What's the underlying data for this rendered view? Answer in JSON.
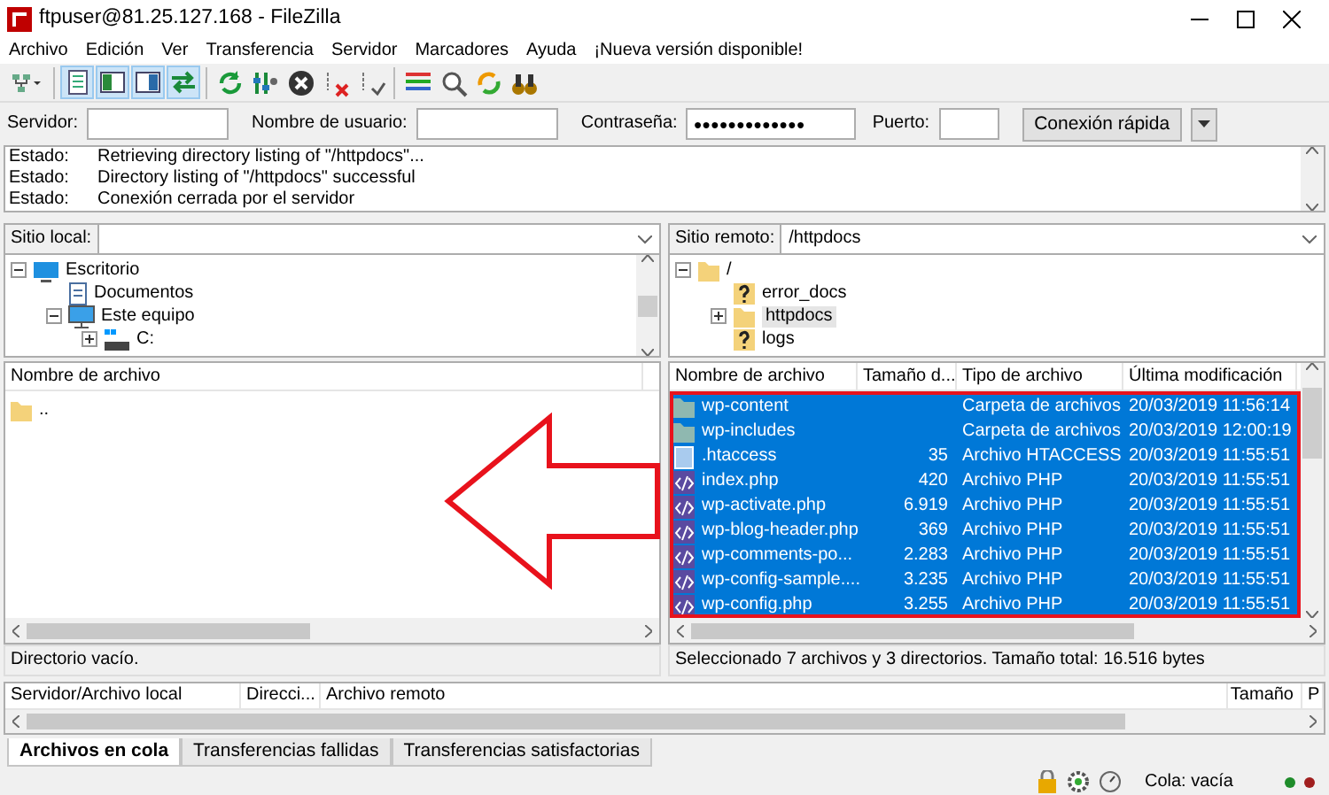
{
  "window": {
    "title": "ftpuser@81.25.127.168 - FileZilla"
  },
  "menu": [
    "Archivo",
    "Edición",
    "Ver",
    "Transferencia",
    "Servidor",
    "Marcadores",
    "Ayuda",
    "¡Nueva versión disponible!"
  ],
  "toolbar": [
    {
      "kind": "sites",
      "pressed": false
    },
    {
      "kind": "sep"
    },
    {
      "kind": "log",
      "pressed": true
    },
    {
      "kind": "localtree",
      "pressed": true
    },
    {
      "kind": "remotetree",
      "pressed": true
    },
    {
      "kind": "queue",
      "pressed": true
    },
    {
      "kind": "sep"
    },
    {
      "kind": "refresh",
      "pressed": false
    },
    {
      "kind": "filter",
      "pressed": false
    },
    {
      "kind": "cancel",
      "pressed": false
    },
    {
      "kind": "disconnect",
      "pressed": false
    },
    {
      "kind": "reconnect",
      "pressed": false
    },
    {
      "kind": "sep"
    },
    {
      "kind": "compare",
      "pressed": false
    },
    {
      "kind": "find",
      "pressed": false
    },
    {
      "kind": "sync",
      "pressed": false
    },
    {
      "kind": "binoculars",
      "pressed": false
    }
  ],
  "quickconnect": {
    "server_label": "Servidor:",
    "user_label": "Nombre de usuario:",
    "password_label": "Contraseña:",
    "password": "●●●●●●●●●●●●●",
    "port_label": "Puerto:",
    "connect_button": "Conexión rápida"
  },
  "log": [
    {
      "label": "Estado:",
      "message": "Retrieving directory listing of \"/httpdocs\"..."
    },
    {
      "label": "Estado:",
      "message": "Directory listing of \"/httpdocs\" successful"
    },
    {
      "label": "Estado:",
      "message": "Conexión cerrada por el servidor"
    }
  ],
  "local": {
    "site_label": "Sitio local:",
    "tree": [
      {
        "label": "Escritorio",
        "kind": "desktop",
        "expanded": true,
        "children": [
          {
            "label": "Documentos",
            "kind": "docs"
          },
          {
            "label": "Este equipo",
            "kind": "pc",
            "expanded": true,
            "children": [
              {
                "label": "C:",
                "kind": "drive",
                "expanded": false
              }
            ]
          }
        ]
      }
    ],
    "columns": [
      "Nombre de archivo"
    ],
    "files": [
      {
        "name": "..",
        "kind": "folder"
      }
    ],
    "status": "Directorio vacío."
  },
  "remote": {
    "site_label": "Sitio remoto:",
    "path": "/httpdocs",
    "tree": [
      {
        "label": "/",
        "kind": "folder",
        "expanded": true,
        "children": [
          {
            "label": "error_docs",
            "kind": "unknown"
          },
          {
            "label": "httpdocs",
            "kind": "folder",
            "expanded": false,
            "selected": true
          },
          {
            "label": "logs",
            "kind": "unknown"
          }
        ]
      }
    ],
    "columns": [
      "Nombre de archivo",
      "Tamaño d...",
      "Tipo de archivo",
      "Última modificación"
    ],
    "files": [
      {
        "name": "wp-content",
        "type": "Carpeta de archivos",
        "modified": "20/03/2019 11:56:14",
        "kind": "folder",
        "selected": true
      },
      {
        "name": "wp-includes",
        "type": "Carpeta de archivos",
        "modified": "20/03/2019 12:00:19",
        "kind": "folder",
        "selected": true
      },
      {
        "name": ".htaccess",
        "size": "35",
        "type": "Archivo HTACCESS",
        "modified": "20/03/2019 11:55:51",
        "kind": "file",
        "selected": true
      },
      {
        "name": "index.php",
        "size": "420",
        "type": "Archivo PHP",
        "modified": "20/03/2019 11:55:51",
        "kind": "php",
        "selected": true
      },
      {
        "name": "wp-activate.php",
        "size": "6.919",
        "type": "Archivo PHP",
        "modified": "20/03/2019 11:55:51",
        "kind": "php",
        "selected": true
      },
      {
        "name": "wp-blog-header.php",
        "size": "369",
        "type": "Archivo PHP",
        "modified": "20/03/2019 11:55:51",
        "kind": "php",
        "selected": true
      },
      {
        "name": "wp-comments-po...",
        "size": "2.283",
        "type": "Archivo PHP",
        "modified": "20/03/2019 11:55:51",
        "kind": "php",
        "selected": true
      },
      {
        "name": "wp-config-sample....",
        "size": "3.235",
        "type": "Archivo PHP",
        "modified": "20/03/2019 11:55:51",
        "kind": "php",
        "selected": true
      },
      {
        "name": "wp-config.php",
        "size": "3.255",
        "type": "Archivo PHP",
        "modified": "20/03/2019 11:55:51",
        "kind": "php",
        "selected": true
      }
    ],
    "status": "Seleccionado 7 archivos y 3 directorios. Tamaño total: 16.516 bytes"
  },
  "queue": {
    "columns": [
      "Servidor/Archivo local",
      "Direcci...",
      "Archivo remoto",
      "Tamaño",
      "P"
    ]
  },
  "tabs": [
    {
      "label": "Archivos en cola",
      "selected": true
    },
    {
      "label": "Transferencias fallidas",
      "selected": false
    },
    {
      "label": "Transferencias satisfactorias",
      "selected": false
    }
  ],
  "status_bar": {
    "queue": "Cola: vacía",
    "lights": [
      {
        "color": "#1e8c2a"
      },
      {
        "color": "#a01e1e"
      }
    ]
  }
}
